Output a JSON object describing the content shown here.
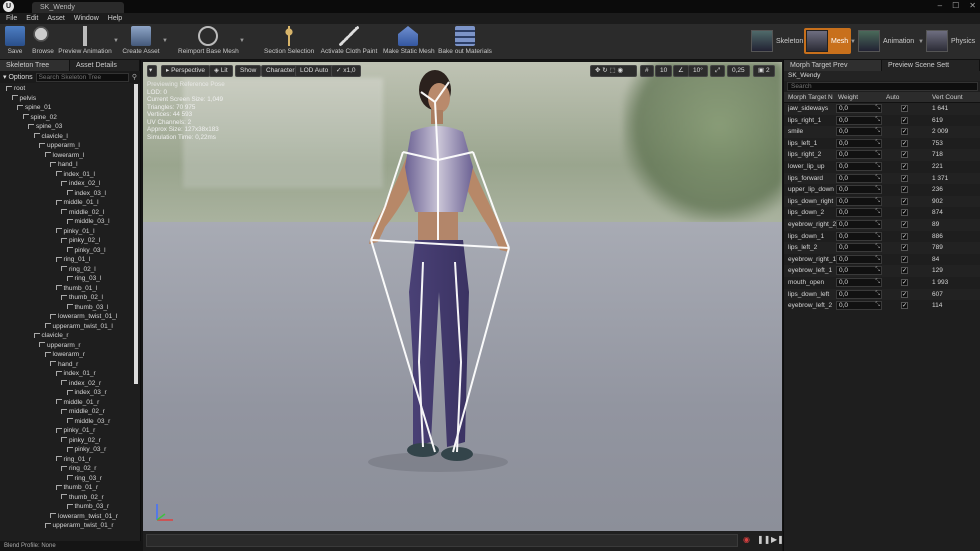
{
  "window": {
    "tab_title": "SK_Wendy",
    "logo_letter": "U"
  },
  "menu": [
    "File",
    "Edit",
    "Asset",
    "Window",
    "Help"
  ],
  "toolbar": {
    "buttons": [
      {
        "label": "Save",
        "icon": "save-icon"
      },
      {
        "label": "Browse",
        "icon": "browse-icon"
      },
      {
        "label": "Preview Animation",
        "icon": "preview-animation-icon"
      },
      {
        "label": "Create Asset",
        "icon": "create-asset-icon"
      },
      {
        "label": "Reimport Base Mesh",
        "icon": "reimport-icon"
      },
      {
        "label": "Section Selection",
        "icon": "section-selection-icon"
      },
      {
        "label": "Activate Cloth Paint",
        "icon": "cloth-paint-icon"
      },
      {
        "label": "Make Static Mesh",
        "icon": "static-mesh-icon"
      },
      {
        "label": "Bake out Materials",
        "icon": "bake-materials-icon"
      }
    ],
    "modes": [
      {
        "label": "Skeleton",
        "active": false
      },
      {
        "label": "Mesh",
        "active": true
      },
      {
        "label": "Animation",
        "active": false
      },
      {
        "label": "Physics",
        "active": false
      }
    ]
  },
  "left_panel": {
    "tabs": [
      "Skeleton Tree",
      "Asset Details"
    ],
    "options_label": "Options",
    "search_placeholder": "Search Skeleton Tree",
    "bones": [
      {
        "name": "root",
        "depth": 0
      },
      {
        "name": "pelvis",
        "depth": 1
      },
      {
        "name": "spine_01",
        "depth": 2
      },
      {
        "name": "spine_02",
        "depth": 3
      },
      {
        "name": "spine_03",
        "depth": 4
      },
      {
        "name": "clavicle_l",
        "depth": 5
      },
      {
        "name": "upperarm_l",
        "depth": 6
      },
      {
        "name": "lowerarm_l",
        "depth": 7
      },
      {
        "name": "hand_l",
        "depth": 8
      },
      {
        "name": "index_01_l",
        "depth": 9
      },
      {
        "name": "index_02_l",
        "depth": 10
      },
      {
        "name": "index_03_l",
        "depth": 11
      },
      {
        "name": "middle_01_l",
        "depth": 9
      },
      {
        "name": "middle_02_l",
        "depth": 10
      },
      {
        "name": "middle_03_l",
        "depth": 11
      },
      {
        "name": "pinky_01_l",
        "depth": 9
      },
      {
        "name": "pinky_02_l",
        "depth": 10
      },
      {
        "name": "pinky_03_l",
        "depth": 11
      },
      {
        "name": "ring_01_l",
        "depth": 9
      },
      {
        "name": "ring_02_l",
        "depth": 10
      },
      {
        "name": "ring_03_l",
        "depth": 11
      },
      {
        "name": "thumb_01_l",
        "depth": 9
      },
      {
        "name": "thumb_02_l",
        "depth": 10
      },
      {
        "name": "thumb_03_l",
        "depth": 11
      },
      {
        "name": "lowerarm_twist_01_l",
        "depth": 8
      },
      {
        "name": "upperarm_twist_01_l",
        "depth": 7
      },
      {
        "name": "clavicle_r",
        "depth": 5
      },
      {
        "name": "upperarm_r",
        "depth": 6
      },
      {
        "name": "lowerarm_r",
        "depth": 7
      },
      {
        "name": "hand_r",
        "depth": 8
      },
      {
        "name": "index_01_r",
        "depth": 9
      },
      {
        "name": "index_02_r",
        "depth": 10
      },
      {
        "name": "index_03_r",
        "depth": 11
      },
      {
        "name": "middle_01_r",
        "depth": 9
      },
      {
        "name": "middle_02_r",
        "depth": 10
      },
      {
        "name": "middle_03_r",
        "depth": 11
      },
      {
        "name": "pinky_01_r",
        "depth": 9
      },
      {
        "name": "pinky_02_r",
        "depth": 10
      },
      {
        "name": "pinky_03_r",
        "depth": 11
      },
      {
        "name": "ring_01_r",
        "depth": 9
      },
      {
        "name": "ring_02_r",
        "depth": 10
      },
      {
        "name": "ring_03_r",
        "depth": 11
      },
      {
        "name": "thumb_01_r",
        "depth": 9
      },
      {
        "name": "thumb_02_r",
        "depth": 10
      },
      {
        "name": "thumb_03_r",
        "depth": 11
      },
      {
        "name": "lowerarm_twist_01_r",
        "depth": 8
      },
      {
        "name": "upperarm_twist_01_r",
        "depth": 7
      }
    ],
    "blend_profile": "Blend Profile: None"
  },
  "viewport": {
    "perspective": "Perspective",
    "lit": "Lit",
    "show": "Show",
    "character": "Character",
    "lod": "LOD Auto",
    "speed": "x1,0",
    "snap_values": [
      "10",
      "10°",
      "0,25",
      "2"
    ],
    "info_lines": [
      "Previewing Reference Pose",
      "LOD: 0",
      "Current Screen Size: 1,049",
      "Triangles: 70 975",
      "Vertices: 44 593",
      "UV Channels: 2",
      "Approx Size: 127x38x183",
      "Simulation Time: 0,22ms"
    ]
  },
  "right_panel": {
    "tabs": [
      "Morph Target Prev",
      "Preview Scene Sett"
    ],
    "asset_name": "SK_Wendy",
    "search_placeholder": "Search",
    "columns": {
      "name": "Morph Target N",
      "weight": "Weight",
      "auto": "Auto",
      "verts": "Vert Count"
    },
    "morphs": [
      {
        "name": "jaw_sideways",
        "weight": "0,0",
        "verts": "1 641"
      },
      {
        "name": "lips_right_1",
        "weight": "0,0",
        "verts": "619"
      },
      {
        "name": "smile",
        "weight": "0,0",
        "verts": "2 009"
      },
      {
        "name": "lips_left_1",
        "weight": "0,0",
        "verts": "753"
      },
      {
        "name": "lips_right_2",
        "weight": "0,0",
        "verts": "718"
      },
      {
        "name": "lower_lip_up",
        "weight": "0,0",
        "verts": "221"
      },
      {
        "name": "lips_forward",
        "weight": "0,0",
        "verts": "1 371"
      },
      {
        "name": "upper_lip_down",
        "weight": "0,0",
        "verts": "236"
      },
      {
        "name": "lips_down_right",
        "weight": "0,0",
        "verts": "902"
      },
      {
        "name": "lips_down_2",
        "weight": "0,0",
        "verts": "874"
      },
      {
        "name": "eyebrow_right_2",
        "weight": "0,0",
        "verts": "89"
      },
      {
        "name": "lips_down_1",
        "weight": "0,0",
        "verts": "886"
      },
      {
        "name": "lips_left_2",
        "weight": "0,0",
        "verts": "789"
      },
      {
        "name": "eyebrow_right_1",
        "weight": "0,0",
        "verts": "84"
      },
      {
        "name": "eyebrow_left_1",
        "weight": "0,0",
        "verts": "129"
      },
      {
        "name": "mouth_open",
        "weight": "0,0",
        "verts": "1 993"
      },
      {
        "name": "lips_down_left",
        "weight": "0,0",
        "verts": "607"
      },
      {
        "name": "eyebrow_left_2",
        "weight": "0,0",
        "verts": "114"
      }
    ]
  },
  "colors": {
    "accent": "#c8701c",
    "panel": "#1e1e1e",
    "record": "#d84040"
  }
}
